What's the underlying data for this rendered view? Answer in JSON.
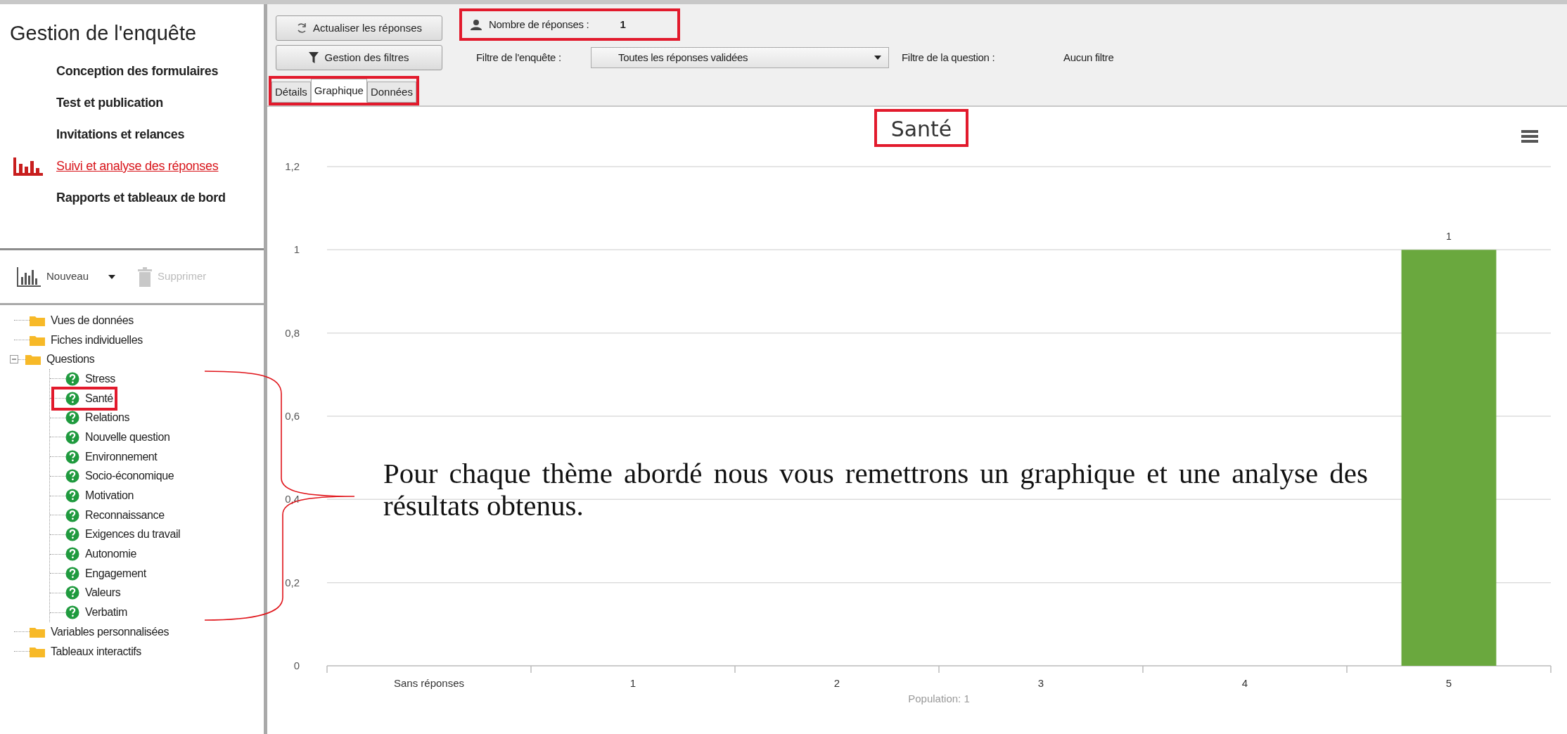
{
  "sidebar": {
    "title": "Gestion de l'enquête",
    "nav": [
      {
        "label": "Conception des formulaires",
        "selected": false
      },
      {
        "label": "Test et publication",
        "selected": false
      },
      {
        "label": "Invitations et relances",
        "selected": false
      },
      {
        "label": "Suivi et analyse des réponses",
        "selected": true
      },
      {
        "label": "Rapports et tableaux de bord",
        "selected": false
      }
    ],
    "toolbar": {
      "new_label": "Nouveau",
      "delete_label": "Supprimer",
      "delete_disabled": true
    },
    "tree": [
      {
        "label": "Vues de données",
        "kind": "folder"
      },
      {
        "label": "Fiches individuelles",
        "kind": "folder"
      },
      {
        "label": "Questions",
        "kind": "folder",
        "expanded": true,
        "children": [
          {
            "label": "Stress",
            "kind": "question",
            "highlighted": false
          },
          {
            "label": "Santé",
            "kind": "question",
            "highlighted": true
          },
          {
            "label": "Relations",
            "kind": "question",
            "highlighted": false
          },
          {
            "label": "Nouvelle question",
            "kind": "question",
            "highlighted": false
          },
          {
            "label": "Environnement",
            "kind": "question",
            "highlighted": false
          },
          {
            "label": "Socio-économique",
            "kind": "question",
            "highlighted": false
          },
          {
            "label": "Motivation",
            "kind": "question",
            "highlighted": false
          },
          {
            "label": "Reconnaissance",
            "kind": "question",
            "highlighted": false
          },
          {
            "label": "Exigences du travail",
            "kind": "question",
            "highlighted": false
          },
          {
            "label": "Autonomie",
            "kind": "question",
            "highlighted": false
          },
          {
            "label": "Engagement",
            "kind": "question",
            "highlighted": false
          },
          {
            "label": "Valeurs",
            "kind": "question",
            "highlighted": false
          },
          {
            "label": "Verbatim",
            "kind": "question",
            "highlighted": false
          }
        ]
      },
      {
        "label": "Variables personnalisées",
        "kind": "folder"
      },
      {
        "label": "Tableaux interactifs",
        "kind": "folder"
      }
    ]
  },
  "toolbar": {
    "refresh_button": "Actualiser les réponses",
    "response_count": {
      "label": "Nombre de réponses :",
      "value": "1",
      "highlighted": true
    },
    "filters_button": "Gestion des filtres",
    "survey_filter_label": "Filtre de l'enquête :",
    "survey_filter_value": "Toutes les réponses validées",
    "question_filter_label": "Filtre de la question :",
    "question_filter_value": "Aucun filtre"
  },
  "tab_strip": {
    "highlighted": true,
    "tabs": [
      {
        "label": "Détails",
        "selected": false
      },
      {
        "label": "Graphique",
        "selected": true
      },
      {
        "label": "Données",
        "selected": false
      }
    ]
  },
  "chart": {
    "title_highlighted": true,
    "chart_data": {
      "type": "bar",
      "title": "Santé",
      "xlabel": "Population: 1",
      "categories": [
        "Sans réponses",
        "1",
        "2",
        "3",
        "4",
        "5"
      ],
      "series": [
        {
          "color": "#6aa83e",
          "values": [
            0,
            0,
            0,
            0,
            0,
            1
          ]
        }
      ],
      "grid": true,
      "ylim": [
        0,
        1.2
      ],
      "yticks": [
        {
          "value": 0,
          "label": "0"
        },
        {
          "value": 0.2,
          "label": "0,2"
        },
        {
          "value": 0.4,
          "label": "0,4"
        },
        {
          "value": 0.6,
          "label": "0,6"
        },
        {
          "value": 0.8,
          "label": "0,8"
        },
        {
          "value": 1,
          "label": "1"
        },
        {
          "value": 1.2,
          "label": "1,2"
        }
      ],
      "value_labels": [
        null,
        null,
        null,
        null,
        null,
        "1"
      ]
    }
  },
  "annotation": {
    "text": "Pour chaque thème abordé nous vous remettrons un graphique et une analyse des résultats obtenus."
  }
}
